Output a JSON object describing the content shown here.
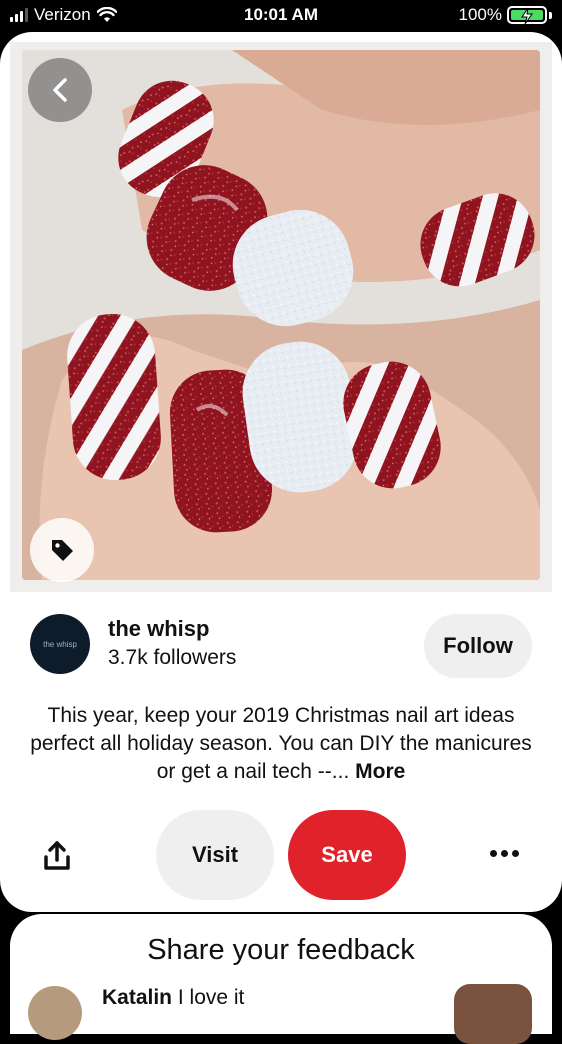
{
  "status_bar": {
    "carrier": "Verizon",
    "time": "10:01 AM",
    "battery": "100%"
  },
  "pin": {
    "image_icons": {
      "back": "chevron-left-icon",
      "tag": "tag-icon"
    }
  },
  "creator": {
    "avatar_text": "the whisp",
    "name": "the whisp",
    "followers": "3.7k followers",
    "follow_label": "Follow"
  },
  "description": {
    "text": "This year, keep your 2019 Christmas nail art ideas perfect all holiday season. You can DIY the manicures or get a nail tech --...",
    "more_label": "More"
  },
  "actions": {
    "share_icon": "share-icon",
    "visit_label": "Visit",
    "save_label": "Save",
    "more_icon": "more-dots-icon"
  },
  "feedback": {
    "title": "Share your feedback",
    "comment_author": "Katalin",
    "comment_text": "I love it"
  },
  "colors": {
    "save_red": "#e0232b",
    "battery_green": "#4cd964",
    "button_grey": "#efefef"
  }
}
